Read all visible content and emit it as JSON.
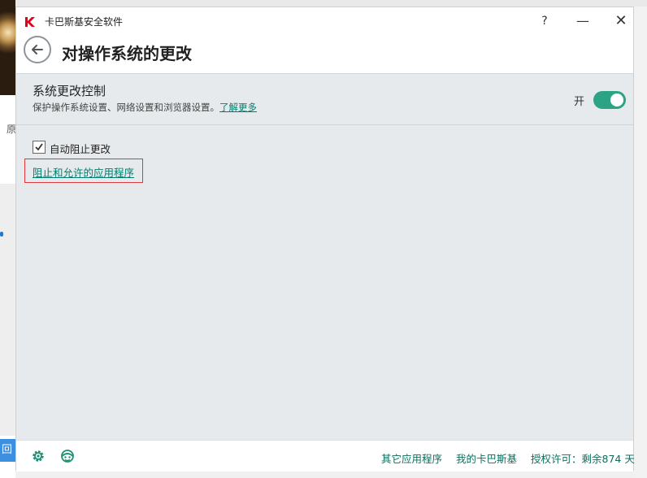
{
  "background": {
    "left_char": "原",
    "bottom_char": "回"
  },
  "window": {
    "app_title": "卡巴斯基安全软件",
    "help_label": "?",
    "minimize_label": "—",
    "close_label": "✕"
  },
  "header": {
    "page_title": "对操作系统的更改"
  },
  "section": {
    "title": "系统更改控制",
    "description": "保护操作系统设置、网络设置和浏览器设置。",
    "learn_more": "了解更多",
    "toggle_label": "开",
    "toggle_on": true
  },
  "options": {
    "auto_block_label": "自动阻止更改",
    "auto_block_checked": true,
    "apps_link": "阻止和允许的应用程序"
  },
  "footer": {
    "other_apps": "其它应用程序",
    "my_kaspersky": "我的卡巴斯基",
    "license": "授权许可：剩余874 天"
  },
  "colors": {
    "accent": "#2ba384",
    "link": "#007f6e",
    "highlight_box": "#e0373b",
    "brand_red": "#e3001b"
  },
  "icons": {
    "app_logo": "kaspersky-logo-icon",
    "back": "arrow-left-icon",
    "settings": "gear-icon",
    "support": "support-icon"
  }
}
